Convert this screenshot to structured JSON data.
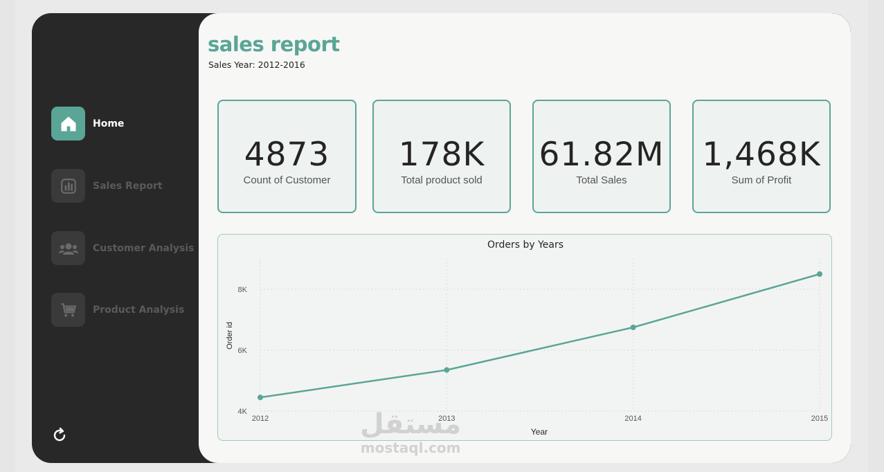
{
  "header": {
    "title": "sales report",
    "subtitle": "Sales Year: 2012-2016"
  },
  "sidebar": {
    "items": [
      {
        "label": "Home",
        "icon": "home-icon",
        "active": true
      },
      {
        "label": "Sales Report",
        "icon": "bar-chart-icon",
        "active": false
      },
      {
        "label": "Customer Analysis",
        "icon": "users-icon",
        "active": false
      },
      {
        "label": "Product Analysis",
        "icon": "cart-icon",
        "active": false
      }
    ],
    "refresh_icon": "refresh-icon"
  },
  "cards": [
    {
      "value": "4873",
      "label": "Count of Customer"
    },
    {
      "value": "178K",
      "label": "Total product sold"
    },
    {
      "value": "61.82M",
      "label": "Total Sales"
    },
    {
      "value": "1,468K",
      "label": "Sum of Profit"
    }
  ],
  "chart_data": {
    "type": "line",
    "title": "Orders by Years",
    "xlabel": "Year",
    "ylabel": "Order id",
    "x": [
      "2012",
      "2013",
      "2014",
      "2015"
    ],
    "series": [
      {
        "values": [
          4450,
          5350,
          6750,
          8500
        ]
      }
    ],
    "ylim": [
      4000,
      9000
    ],
    "yticks": [
      {
        "value": 4000,
        "label": "4K"
      },
      {
        "value": 6000,
        "label": "6K"
      },
      {
        "value": 8000,
        "label": "8K"
      }
    ],
    "grid": true,
    "color": "#5aa596"
  },
  "watermark": {
    "arabic": "مستقل",
    "latin": "mostaql.com"
  },
  "colors": {
    "accent": "#5aa596",
    "sidebar_bg": "#282828",
    "content_bg": "#f7f7f5"
  }
}
